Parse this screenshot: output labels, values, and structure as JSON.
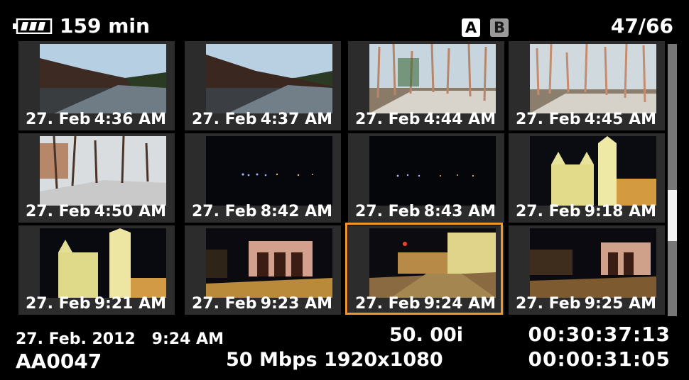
{
  "status": {
    "battery_remaining": "159 min",
    "slot_a": "A",
    "slot_b": "B",
    "counter": "47/66"
  },
  "thumbnails": [
    {
      "date": "27. Feb",
      "time": "4:36 AM",
      "selected": false
    },
    {
      "date": "27. Feb",
      "time": "4:37 AM",
      "selected": false
    },
    {
      "date": "27. Feb",
      "time": "4:44 AM",
      "selected": false
    },
    {
      "date": "27. Feb",
      "time": "4:45 AM",
      "selected": false
    },
    {
      "date": "27. Feb",
      "time": "4:50 AM",
      "selected": false
    },
    {
      "date": "27. Feb",
      "time": "8:42 AM",
      "selected": false
    },
    {
      "date": "27. Feb",
      "time": "8:43 AM",
      "selected": false
    },
    {
      "date": "27. Feb",
      "time": "9:18 AM",
      "selected": false
    },
    {
      "date": "27. Feb",
      "time": "9:21 AM",
      "selected": false
    },
    {
      "date": "27. Feb",
      "time": "9:23 AM",
      "selected": false
    },
    {
      "date": "27. Feb",
      "time": "9:24 AM",
      "selected": true
    },
    {
      "date": "27. Feb",
      "time": "9:25 AM",
      "selected": false
    }
  ],
  "info": {
    "recorded": "27. Feb. 2012   9:24 AM",
    "clip": "AA0047",
    "frame_rate": "50. 00i",
    "bitrate_resolution": "50 Mbps 1920x1080",
    "timecode": "00:30:37:13",
    "duration": "00:00:31:05"
  },
  "colors": {
    "selection": "#f0962c",
    "tile_bg": "#2c2c2c",
    "scrollbar": "#777777"
  }
}
